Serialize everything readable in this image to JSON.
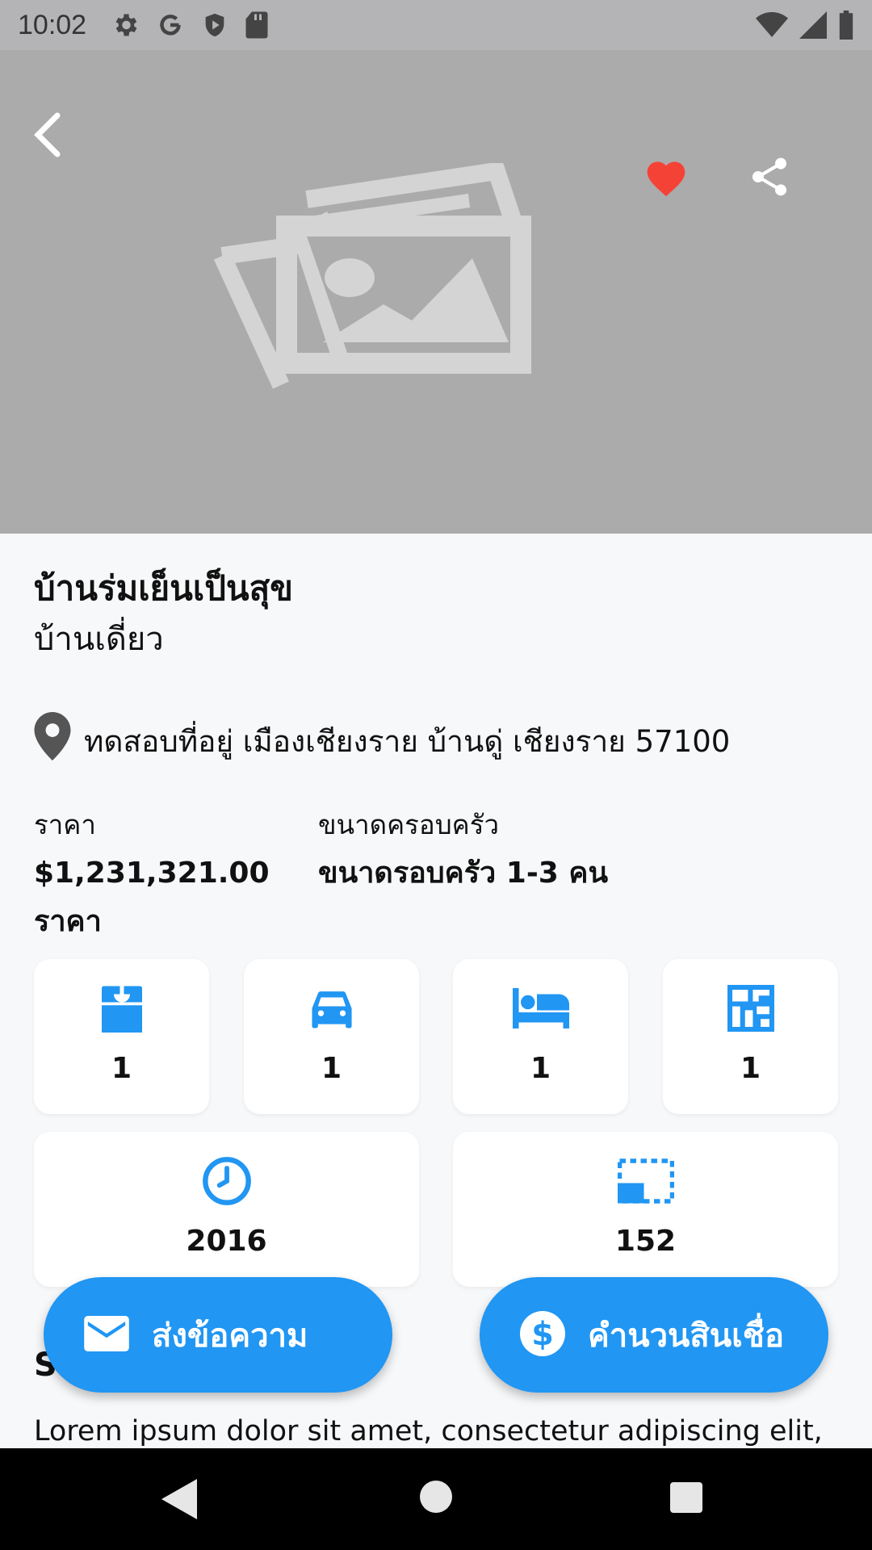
{
  "status_bar": {
    "time": "10:02",
    "left_icons": [
      "gear-icon",
      "google-icon",
      "shield-icon",
      "sd-card-icon"
    ],
    "right_icons": [
      "wifi-icon",
      "signal-icon",
      "battery-icon"
    ]
  },
  "hero": {
    "image": "image-placeholder-icon",
    "favorite_color": "#f44336"
  },
  "property": {
    "title": "บ้านร่มเย็นเป็นสุข",
    "type": "บ้านเดี่ยว",
    "address": "ทดสอบที่อยู่ เมืองเชียงราย บ้านดู่ เชียงราย 57100"
  },
  "info": {
    "price_label": "ราคา",
    "price_value": "$1,231,321.00 ราคา",
    "family_label": "ขนาดครอบครัว",
    "family_value": "ขนาดรอบครัว 1-3 คน"
  },
  "stats": [
    {
      "icon": "bathroom-icon",
      "value": "1"
    },
    {
      "icon": "car-icon",
      "value": "1"
    },
    {
      "icon": "bed-icon",
      "value": "1"
    },
    {
      "icon": "floor-plan-icon",
      "value": "1"
    },
    {
      "icon": "clock-icon",
      "value": "2016"
    },
    {
      "icon": "area-icon",
      "value": "152"
    }
  ],
  "section": {
    "heading": "S",
    "description": "Lorem ipsum dolor sit amet, consectetur adipiscing elit,"
  },
  "actions": {
    "message_label": "ส่งข้อความ",
    "loan_label": "คำนวนสินเชื่อ"
  },
  "colors": {
    "accent": "#2196f3",
    "background": "#f7f8fa",
    "hero": "#ababab"
  }
}
